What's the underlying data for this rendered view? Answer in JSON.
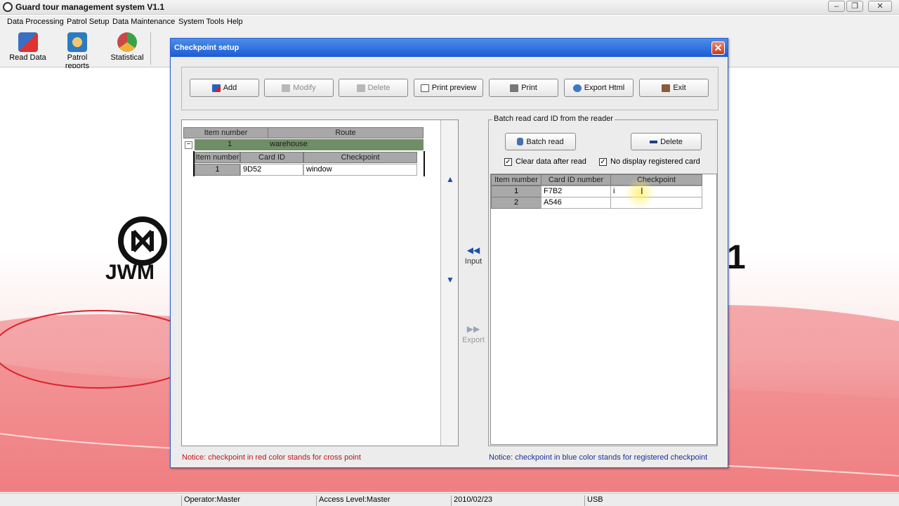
{
  "app": {
    "title": "Guard tour management system V1.1"
  },
  "menu": [
    "Data Processing",
    "Patrol Setup",
    "Data Maintenance",
    "System Tools",
    "Help"
  ],
  "toolbar": {
    "read_data": "Read Data",
    "patrol_reports": "Patrol reports",
    "statistical": "Statistical"
  },
  "status": {
    "operator": "Operator:Master",
    "access": "Access Level:Master",
    "date": "2010/02/23",
    "port": "USB"
  },
  "dialog": {
    "title": "Checkpoint setup",
    "buttons": {
      "add": "Add",
      "modify": "Modify",
      "delete": "Delete",
      "print_preview": "Print preview",
      "print": "Print",
      "export_html": "Export Html",
      "exit": "Exit"
    },
    "left": {
      "headers": {
        "item_number": "Item number",
        "route": "Route"
      },
      "route_row": {
        "item": "1",
        "route": "warehouse"
      },
      "sub_headers": {
        "item_number": "Item number",
        "card_id": "Card ID",
        "checkpoint": "Checkpoint"
      },
      "sub_row": {
        "item": "1",
        "card_id": "9D52",
        "checkpoint": "window"
      }
    },
    "middle": {
      "input": "Input",
      "export": "Export"
    },
    "right": {
      "legend": "Batch read card ID from the reader",
      "batch_read": "Batch read",
      "delete": "Delete",
      "clear_data": "Clear data after read",
      "no_display": "No display registered card",
      "headers": {
        "item_number": "Item number",
        "card_id_number": "Card ID number",
        "checkpoint": "Checkpoint"
      },
      "rows": [
        {
          "item": "1",
          "card_id": "F7B2",
          "checkpoint": "i"
        },
        {
          "item": "2",
          "card_id": "A546",
          "checkpoint": ""
        }
      ]
    },
    "notice_left": "Notice: checkpoint in red color stands for cross point",
    "notice_right": "Notice: checkpoint in blue color stands for registered checkpoint"
  },
  "background": {
    "logo_text": "JWM",
    "version_digit": "1"
  },
  "colors": {
    "title_blue": "#1d5ad6",
    "group_green": "#6f8e65",
    "notice_red": "#c0141a",
    "notice_blue": "#1f2f9a"
  }
}
